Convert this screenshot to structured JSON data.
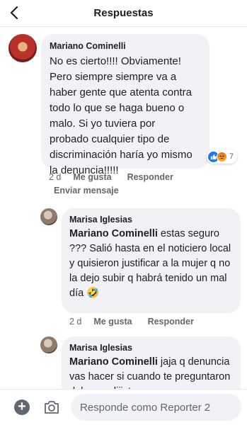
{
  "header": {
    "title": "Respuestas"
  },
  "main_comment": {
    "author": "Mariano Cominelli",
    "text": "No es cierto!!!! Obviamente!\nPero siempre siempre va a\nhaber gente que atenta contra\ntodo lo que se haga bueno o\nmalo. Si yo tuviera por\nprobado cualquier tipo de\ndiscriminación haría yo mismo\nla denuncia!!!!!",
    "reactions": {
      "count": "7",
      "icons": [
        "like-icon",
        "angry-icon"
      ]
    },
    "time": "2 d",
    "like_label": "Me gusta",
    "reply_label": "Responder",
    "message_label": "Enviar mensaje"
  },
  "replies": [
    {
      "author": "Marisa Iglesias",
      "mention": "Mariano Cominelli",
      "text": " estas seguro ??? Salió hasta en el noticiero local y quisieron justificar a la mujer q no la dejo subir q habrá tenido un mal día 🤣",
      "time": "2 d",
      "like_label": "Me gusta",
      "reply_label": "Responder"
    },
    {
      "author": "Marisa Iglesias",
      "mention": "Mariano Cominelli",
      "text": " jaja q denuncia vas hacer si cuando te preguntaron del caso dijiste q"
    }
  ],
  "composer": {
    "placeholder": "Responde como Reporter 2"
  },
  "colors": {
    "accent": "#1877f2",
    "bubble": "#f0f2f5",
    "meta": "#65676b"
  }
}
